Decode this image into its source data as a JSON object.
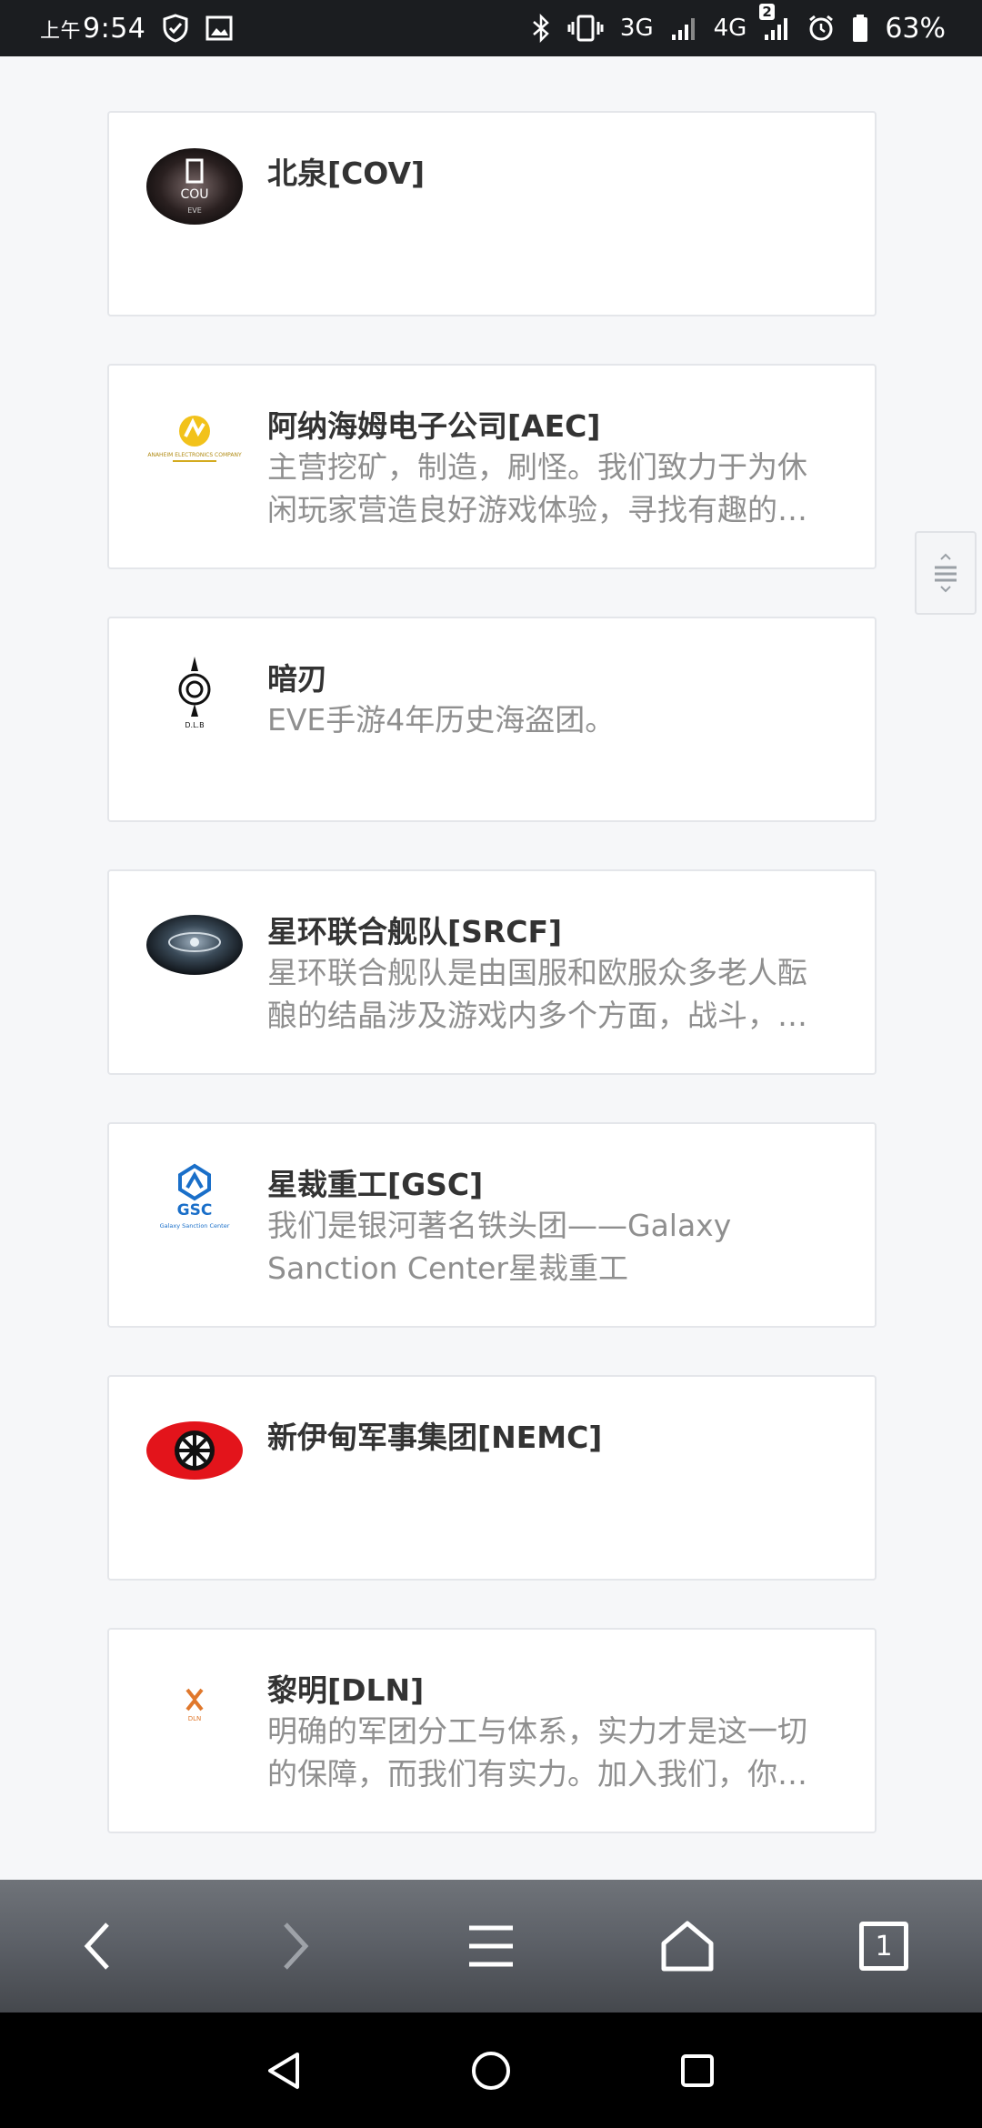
{
  "status_bar": {
    "time_prefix": "上午",
    "time": "9:54",
    "network_3g": "3G",
    "network_4g": "4G",
    "sim2_badge": "2",
    "battery": "63%"
  },
  "corps": [
    {
      "title": "北泉[COV]",
      "desc": "",
      "logo": "cov-logo-icon"
    },
    {
      "title": "阿纳海姆电子公司[AEC]",
      "desc": "主营挖矿，制造，刷怪。我们致力于为休闲玩家营造良好游戏体验，寻找有趣的…",
      "logo": "aec-logo-icon"
    },
    {
      "title": "暗刃",
      "desc": "EVE手游4年历史海盗团。",
      "logo": "dlb-logo-icon"
    },
    {
      "title": "星环联合舰队[SRCF]",
      "desc": "星环联合舰队是由国服和欧服众多老人酝酿的结晶涉及游戏内多个方面，战斗，…",
      "logo": "srcf-logo-icon"
    },
    {
      "title": "星裁重工[GSC]",
      "desc": "我们是银河著名铁头团——Galaxy Sanction Center星裁重工",
      "logo": "gsc-logo-icon"
    },
    {
      "title": "新伊甸军事集团[NEMC]",
      "desc": "",
      "logo": "nemc-logo-icon"
    },
    {
      "title": "黎明[DLN]",
      "desc": "明确的军团分工与体系，实力才是这一切的保障，而我们有实力。加入我们，你…",
      "logo": "dln-logo-icon"
    }
  ],
  "logos": {
    "cov_text_top": "COU",
    "cov_text_bottom": "EVE",
    "aec_text": "ANAHEIM ELECTRONICS COMPANY",
    "dlb_text": "D.L.B",
    "gsc_text": "GSC",
    "gsc_sub": "Galaxy Sanction Center",
    "dln_text": "DLN"
  },
  "browser_bar": {
    "tab_count": "1"
  },
  "colors": {
    "card_border": "#e4e6ea",
    "title": "#333333",
    "desc": "#8f8f8f",
    "gsc_blue": "#1a6fc9",
    "nemc_red": "#e3141b"
  }
}
